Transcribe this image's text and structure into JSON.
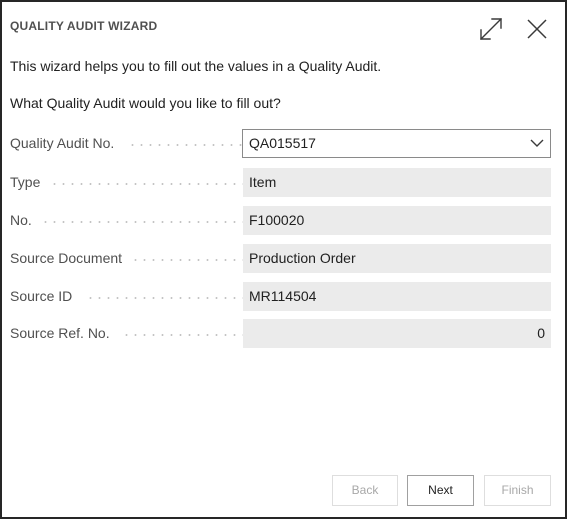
{
  "window": {
    "title": "QUALITY AUDIT WIZARD",
    "expand_icon": "expand-icon",
    "close_icon": "close-icon"
  },
  "intro": {
    "line1": "This wizard helps you to fill out the values in a Quality Audit.",
    "line2": "What Quality Audit would you like to fill out?"
  },
  "fields": {
    "quality_audit_no": {
      "label": "Quality Audit No.",
      "value": "QA015517"
    },
    "type": {
      "label": "Type",
      "value": "Item"
    },
    "no": {
      "label": "No.",
      "value": "F100020"
    },
    "source_document": {
      "label": "Source Document",
      "value": "Production Order"
    },
    "source_id": {
      "label": "Source ID",
      "value": "MR114504"
    },
    "source_ref_no": {
      "label": "Source Ref. No.",
      "value": "0"
    }
  },
  "buttons": {
    "back": "Back",
    "next": "Next",
    "finish": "Finish"
  }
}
